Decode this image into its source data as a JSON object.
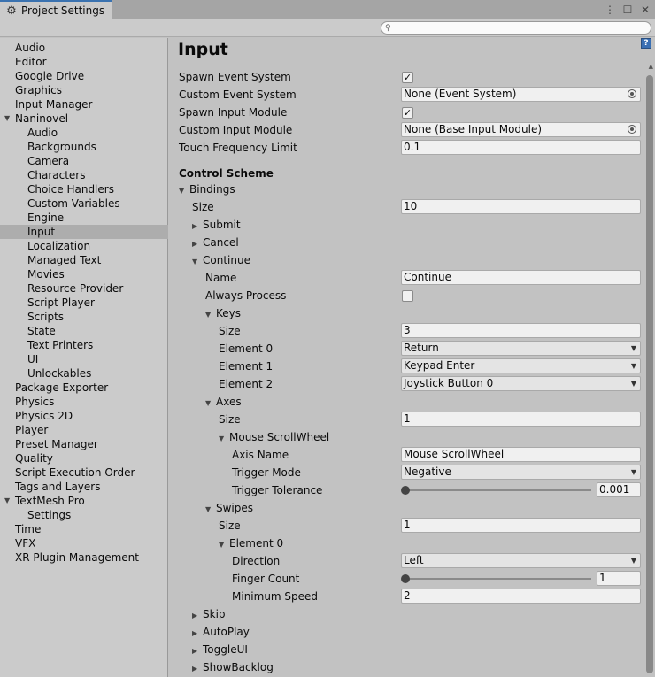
{
  "window": {
    "tab_title": "Project Settings",
    "search_placeholder": ""
  },
  "sidebar": {
    "items": [
      {
        "label": "Audio"
      },
      {
        "label": "Editor"
      },
      {
        "label": "Google Drive"
      },
      {
        "label": "Graphics"
      },
      {
        "label": "Input Manager"
      },
      {
        "label": "Naninovel"
      },
      {
        "label": "Audio"
      },
      {
        "label": "Backgrounds"
      },
      {
        "label": "Camera"
      },
      {
        "label": "Characters"
      },
      {
        "label": "Choice Handlers"
      },
      {
        "label": "Custom Variables"
      },
      {
        "label": "Engine"
      },
      {
        "label": "Input"
      },
      {
        "label": "Localization"
      },
      {
        "label": "Managed Text"
      },
      {
        "label": "Movies"
      },
      {
        "label": "Resource Provider"
      },
      {
        "label": "Script Player"
      },
      {
        "label": "Scripts"
      },
      {
        "label": "State"
      },
      {
        "label": "Text Printers"
      },
      {
        "label": "UI"
      },
      {
        "label": "Unlockables"
      },
      {
        "label": "Package Exporter"
      },
      {
        "label": "Physics"
      },
      {
        "label": "Physics 2D"
      },
      {
        "label": "Player"
      },
      {
        "label": "Preset Manager"
      },
      {
        "label": "Quality"
      },
      {
        "label": "Script Execution Order"
      },
      {
        "label": "Tags and Layers"
      },
      {
        "label": "TextMesh Pro"
      },
      {
        "label": "Settings"
      },
      {
        "label": "Time"
      },
      {
        "label": "VFX"
      },
      {
        "label": "XR Plugin Management"
      }
    ]
  },
  "main": {
    "title": "Input",
    "spawn_event_system": {
      "label": "Spawn Event System",
      "checked": true
    },
    "custom_event_system": {
      "label": "Custom Event System",
      "value": "None (Event System)"
    },
    "spawn_input_module": {
      "label": "Spawn Input Module",
      "checked": true
    },
    "custom_input_module": {
      "label": "Custom Input Module",
      "value": "None (Base Input Module)"
    },
    "touch_frequency_limit": {
      "label": "Touch Frequency Limit",
      "value": "0.1"
    },
    "control_scheme_header": "Control Scheme",
    "bindings": {
      "label": "Bindings",
      "size_label": "Size",
      "size_value": "10",
      "submit_label": "Submit",
      "cancel_label": "Cancel",
      "continue": {
        "label": "Continue",
        "name_label": "Name",
        "name_value": "Continue",
        "always_process_label": "Always Process",
        "always_process_checked": false,
        "keys": {
          "label": "Keys",
          "size_label": "Size",
          "size_value": "3",
          "elements": [
            {
              "label": "Element 0",
              "value": "Return"
            },
            {
              "label": "Element 1",
              "value": "Keypad Enter"
            },
            {
              "label": "Element 2",
              "value": "Joystick Button 0"
            }
          ]
        },
        "axes": {
          "label": "Axes",
          "size_label": "Size",
          "size_value": "1",
          "mouse_scrollwheel": {
            "label": "Mouse ScrollWheel",
            "axis_name_label": "Axis Name",
            "axis_name_value": "Mouse ScrollWheel",
            "trigger_mode_label": "Trigger Mode",
            "trigger_mode_value": "Negative",
            "trigger_tolerance_label": "Trigger Tolerance",
            "trigger_tolerance_value": "0.001",
            "trigger_tolerance_slider_fraction": 0.0
          }
        },
        "swipes": {
          "label": "Swipes",
          "size_label": "Size",
          "size_value": "1",
          "element0": {
            "label": "Element 0",
            "direction_label": "Direction",
            "direction_value": "Left",
            "finger_count_label": "Finger Count",
            "finger_count_value": "1",
            "finger_count_slider_fraction": 0.0,
            "minimum_speed_label": "Minimum Speed",
            "minimum_speed_value": "2"
          }
        }
      },
      "skip_label": "Skip",
      "autoplay_label": "AutoPlay",
      "toggleui_label": "ToggleUI",
      "showbacklog_label": "ShowBacklog"
    }
  }
}
